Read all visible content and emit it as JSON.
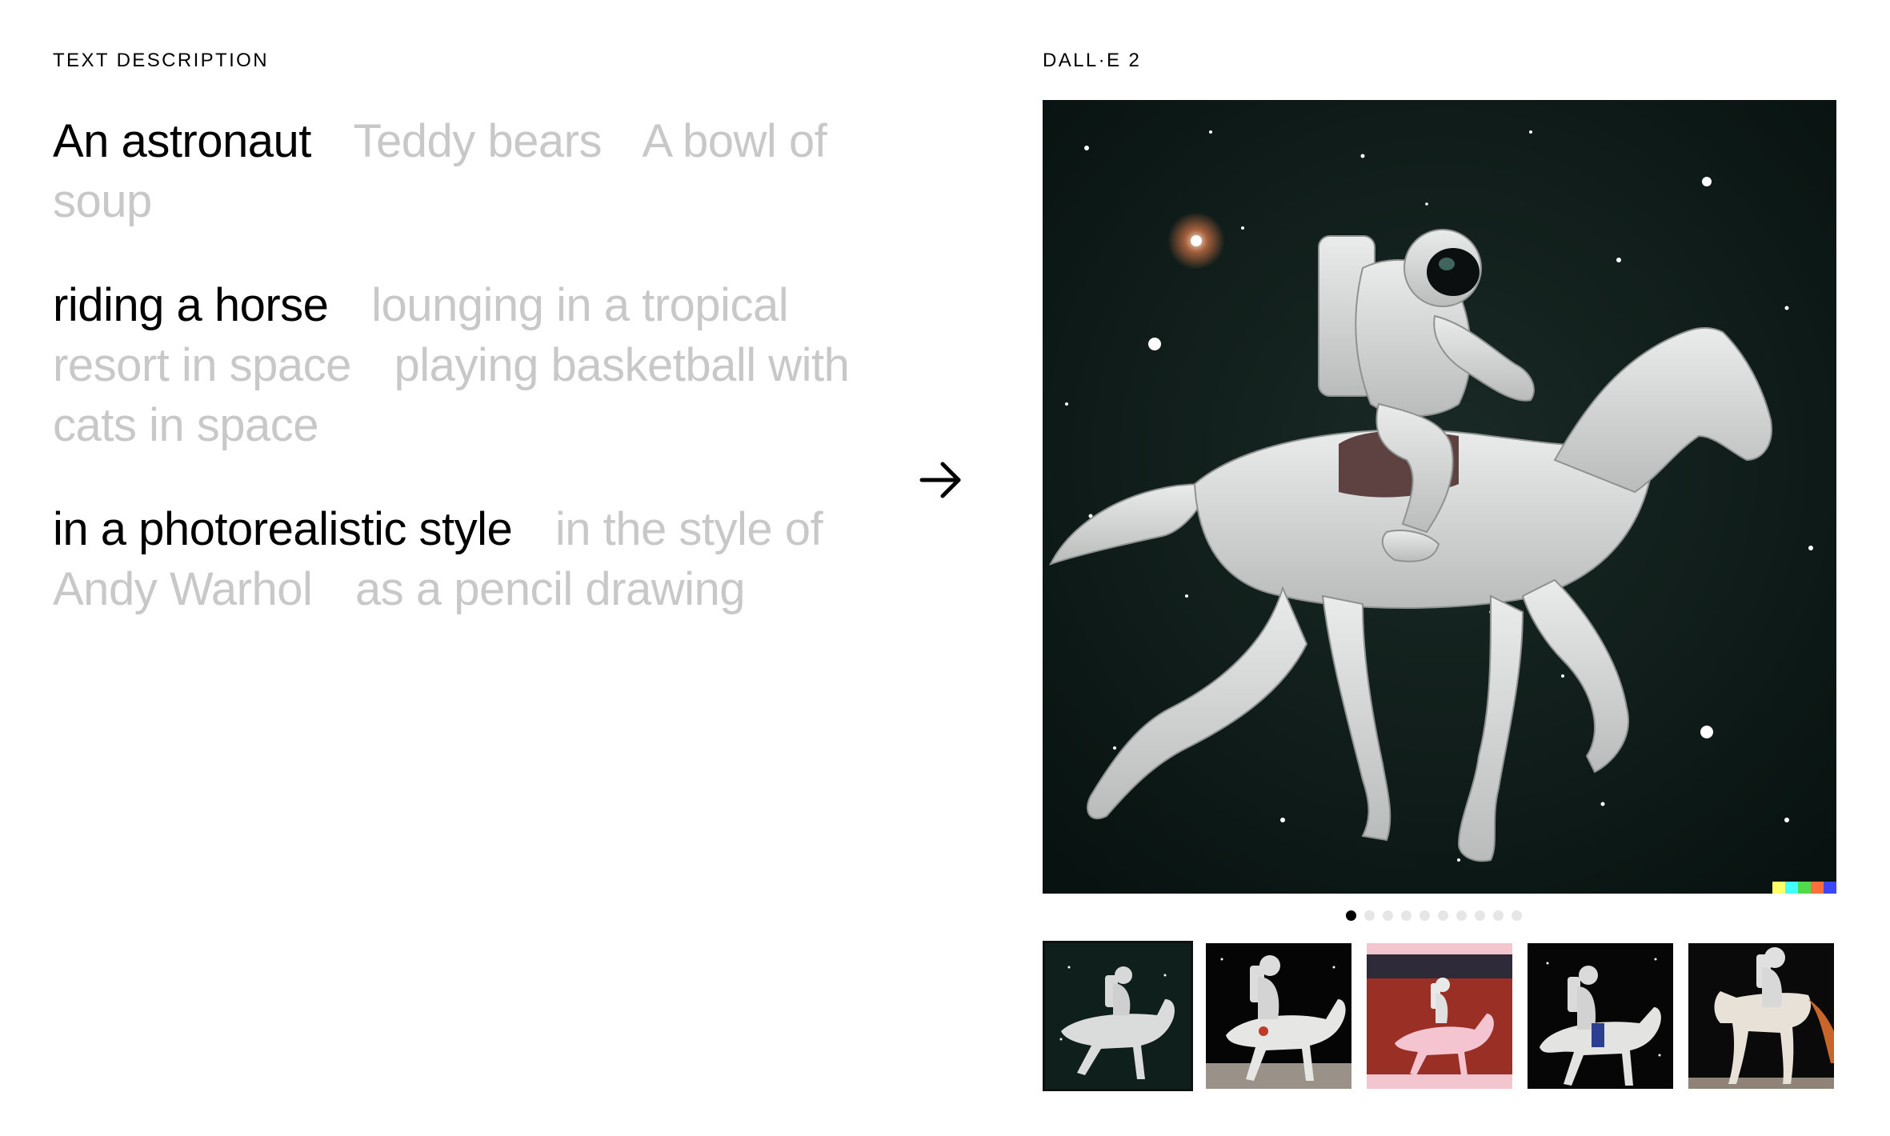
{
  "left": {
    "label": "TEXT DESCRIPTION",
    "groups": [
      {
        "options": [
          "An astronaut",
          "Teddy bears",
          "A bowl of soup"
        ],
        "active": 0
      },
      {
        "options": [
          "riding a horse",
          "lounging in a tropical resort in space",
          "playing basketball with cats in space"
        ],
        "active": 0
      },
      {
        "options": [
          "in a photorealistic style",
          "in the style of Andy Warhol",
          "as a pencil drawing"
        ],
        "active": 0
      }
    ]
  },
  "arrow": {
    "icon": "arrow-right-icon"
  },
  "right": {
    "label": "DALL·E 2",
    "main_image": {
      "description_icon": "astronaut-on-horse-in-space-image"
    },
    "pagination": {
      "count": 10,
      "active": 0
    },
    "thumbnails": [
      {
        "name": "thumb-1",
        "background": "#0f1f1c"
      },
      {
        "name": "thumb-2",
        "background": "#050505"
      },
      {
        "name": "thumb-3",
        "background": "#9a2f25"
      },
      {
        "name": "thumb-4",
        "background": "#060606"
      },
      {
        "name": "thumb-5",
        "background": "#0a0a0a"
      }
    ],
    "active_thumbnail": 0
  },
  "colors": {
    "active_text": "#000000",
    "inactive_text": "#c8c8c8",
    "space_bg": "#0d1a18"
  }
}
